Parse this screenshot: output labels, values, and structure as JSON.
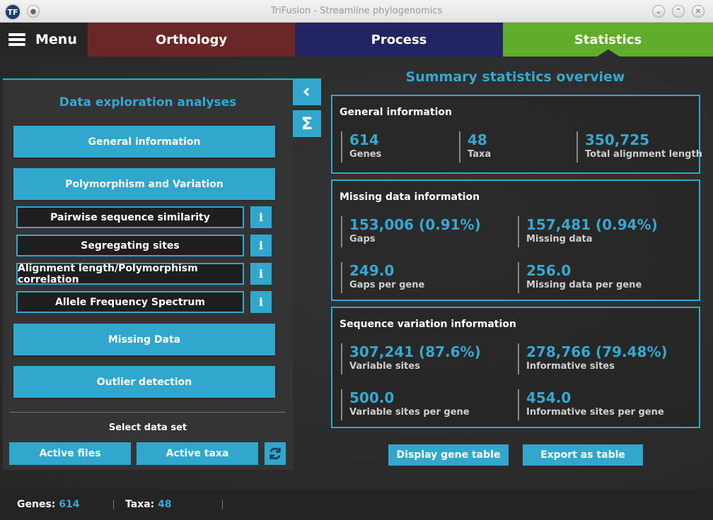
{
  "window": {
    "title": "TriFusion - Streamline phylogenomics",
    "logo_text": "TF"
  },
  "nav": {
    "menu_label": "Menu",
    "tabs": [
      {
        "label": "Orthology",
        "color": "#6b2728"
      },
      {
        "label": "Process",
        "color": "#232462"
      },
      {
        "label": "Statistics",
        "color": "#5fad2b",
        "active": true
      }
    ]
  },
  "left_panel": {
    "title": "Data exploration analyses",
    "general_info": "General information",
    "polymorphism": "Polymorphism and Variation",
    "sub_items": [
      {
        "label": "Pairwise sequence similarity",
        "info": "i"
      },
      {
        "label": "Segregating sites",
        "info": "i"
      },
      {
        "label": "Alignment length/Polymorphism correlation",
        "info": "i"
      },
      {
        "label": "Allele Frequency Spectrum",
        "info": "i"
      }
    ],
    "missing_data": "Missing Data",
    "outlier": "Outlier detection",
    "select_label": "Select data set",
    "active_files": "Active files",
    "active_taxa": "Active taxa"
  },
  "side_buttons": {
    "collapse_icon": "chevron-left-icon",
    "summary_icon": "sigma-icon"
  },
  "summary": {
    "title": "Summary statistics overview",
    "general": {
      "title": "General information",
      "stats": [
        {
          "value": "614",
          "label": "Genes"
        },
        {
          "value": "48",
          "label": "Taxa"
        },
        {
          "value": "350,725",
          "label": "Total alignment length"
        }
      ]
    },
    "missing": {
      "title": "Missing data information",
      "stats": [
        {
          "value": "153,006 (0.91%)",
          "label": "Gaps"
        },
        {
          "value": "157,481 (0.94%)",
          "label": "Missing data"
        },
        {
          "value": "249.0",
          "label": "Gaps per gene"
        },
        {
          "value": "256.0",
          "label": "Missing data per gene"
        }
      ]
    },
    "variation": {
      "title": "Sequence variation information",
      "stats": [
        {
          "value": "307,241 (87.6%)",
          "label": "Variable sites"
        },
        {
          "value": "278,766 (79.48%)",
          "label": "Informative sites"
        },
        {
          "value": "500.0",
          "label": "Variable sites per gene"
        },
        {
          "value": "454.0",
          "label": "Informative sites per gene"
        }
      ]
    },
    "display_gene_table": "Display gene table",
    "export_table": "Export as table"
  },
  "statusbar": {
    "genes_label": "Genes:",
    "genes_value": "614",
    "taxa_label": "Taxa:",
    "taxa_value": "48"
  },
  "colors": {
    "accent": "#31a7cd",
    "accent_text": "#36a8d0"
  }
}
